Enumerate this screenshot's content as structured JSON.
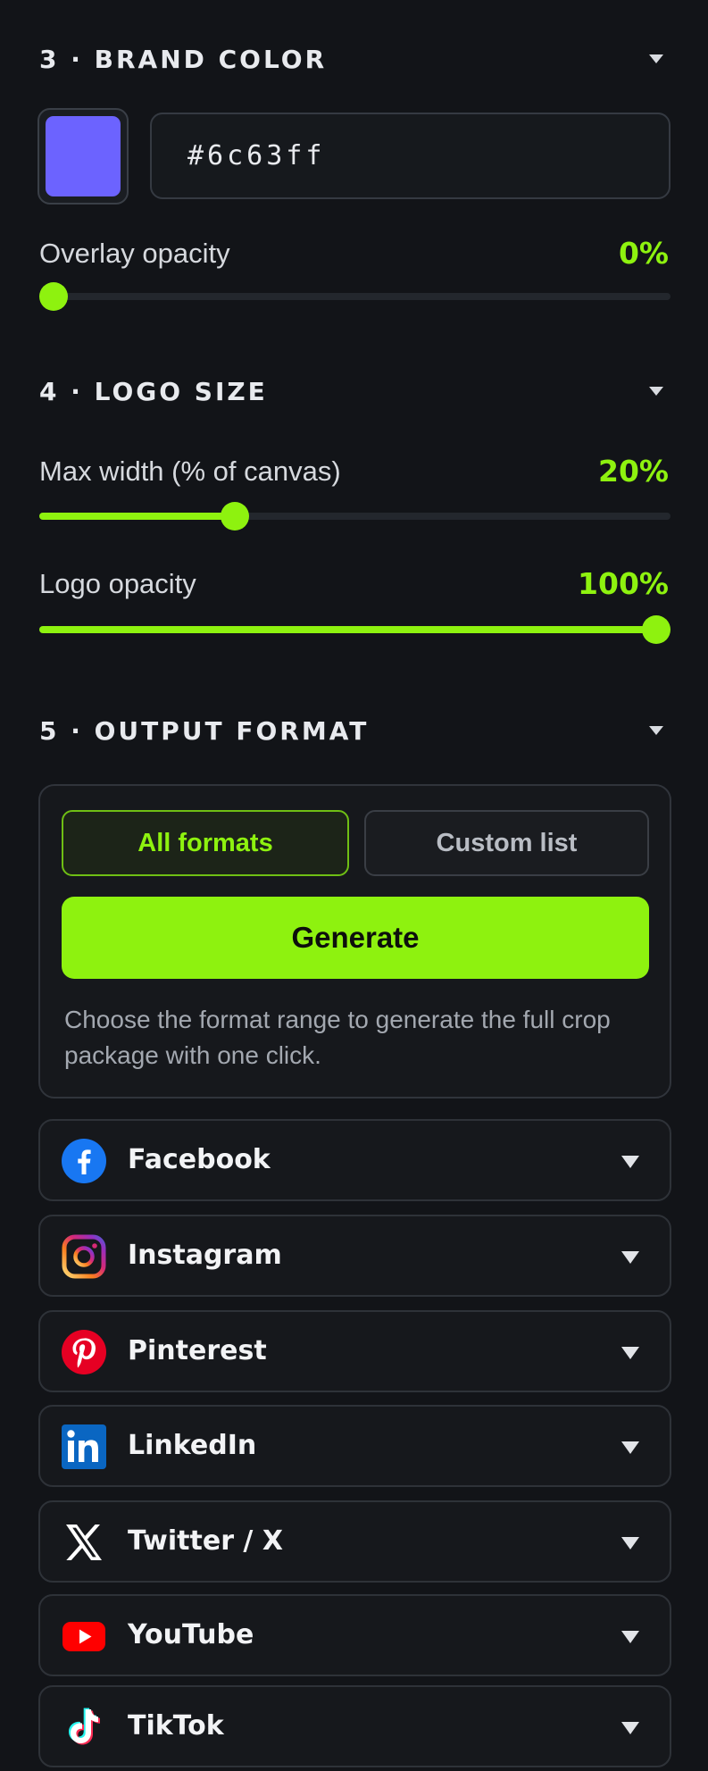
{
  "sections": {
    "brand_color": {
      "title": "3 · BRAND COLOR"
    },
    "logo_size": {
      "title": "4 · LOGO SIZE"
    },
    "output_format": {
      "title": "5 · OUTPUT FORMAT"
    }
  },
  "brand_color": {
    "hex_value": "#6c63ff",
    "swatch_color": "#6c63ff",
    "overlay_opacity": {
      "label": "Overlay opacity",
      "display": "0%",
      "value_percent": 0
    }
  },
  "logo_size": {
    "max_width": {
      "label": "Max width (% of canvas)",
      "display": "20%",
      "value_percent": 30
    },
    "logo_opacity": {
      "label": "Logo opacity",
      "display": "100%",
      "value_percent": 100
    }
  },
  "output_format": {
    "options": [
      "All formats",
      "Custom list"
    ],
    "selected": "All formats",
    "generate_label": "Generate",
    "help_text": "Choose the format range to generate the full crop package with one click."
  },
  "platforms": [
    {
      "label": "Facebook",
      "icon": "facebook-icon"
    },
    {
      "label": "Instagram",
      "icon": "instagram-icon"
    },
    {
      "label": "Pinterest",
      "icon": "pinterest-icon"
    },
    {
      "label": "LinkedIn",
      "icon": "linkedin-icon"
    },
    {
      "label": "Twitter / X",
      "icon": "x-icon"
    },
    {
      "label": "YouTube",
      "icon": "youtube-icon"
    },
    {
      "label": "TikTok",
      "icon": "tiktok-icon"
    }
  ],
  "colors": {
    "accent": "#8ef20f",
    "background": "#121418",
    "card": "#16181c"
  }
}
